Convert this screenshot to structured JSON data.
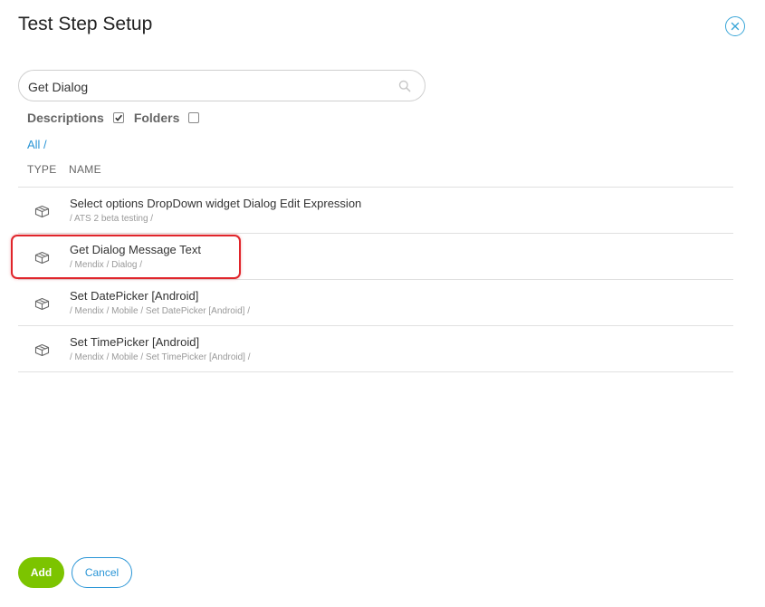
{
  "dialog": {
    "title": "Test Step Setup",
    "close_icon": "close-circle-icon"
  },
  "search": {
    "value": "Get Dialog",
    "icon": "search-icon"
  },
  "filters": {
    "descriptions_label": "Descriptions",
    "descriptions_checked": true,
    "folders_label": "Folders",
    "folders_checked": false
  },
  "breadcrumb": "All /",
  "columns": {
    "type": "TYPE",
    "name": "NAME"
  },
  "results": [
    {
      "name": "Select options DropDown widget Dialog Edit Expression",
      "path": "/ ATS 2 beta testing /",
      "icon": "box-icon"
    },
    {
      "name": "Get Dialog Message Text",
      "path": "/ Mendix / Dialog /",
      "icon": "box-icon",
      "highlighted": true
    },
    {
      "name": "Set DatePicker [Android]",
      "path": "/ Mendix / Mobile / Set DatePicker [Android] /",
      "icon": "box-icon"
    },
    {
      "name": "Set TimePicker [Android]",
      "path": "/ Mendix / Mobile / Set TimePicker [Android] /",
      "icon": "box-icon"
    }
  ],
  "buttons": {
    "add": "Add",
    "cancel": "Cancel"
  },
  "colors": {
    "accent_blue": "#2a95d6",
    "add_green": "#7cc400",
    "highlight_red": "#e0252b"
  }
}
